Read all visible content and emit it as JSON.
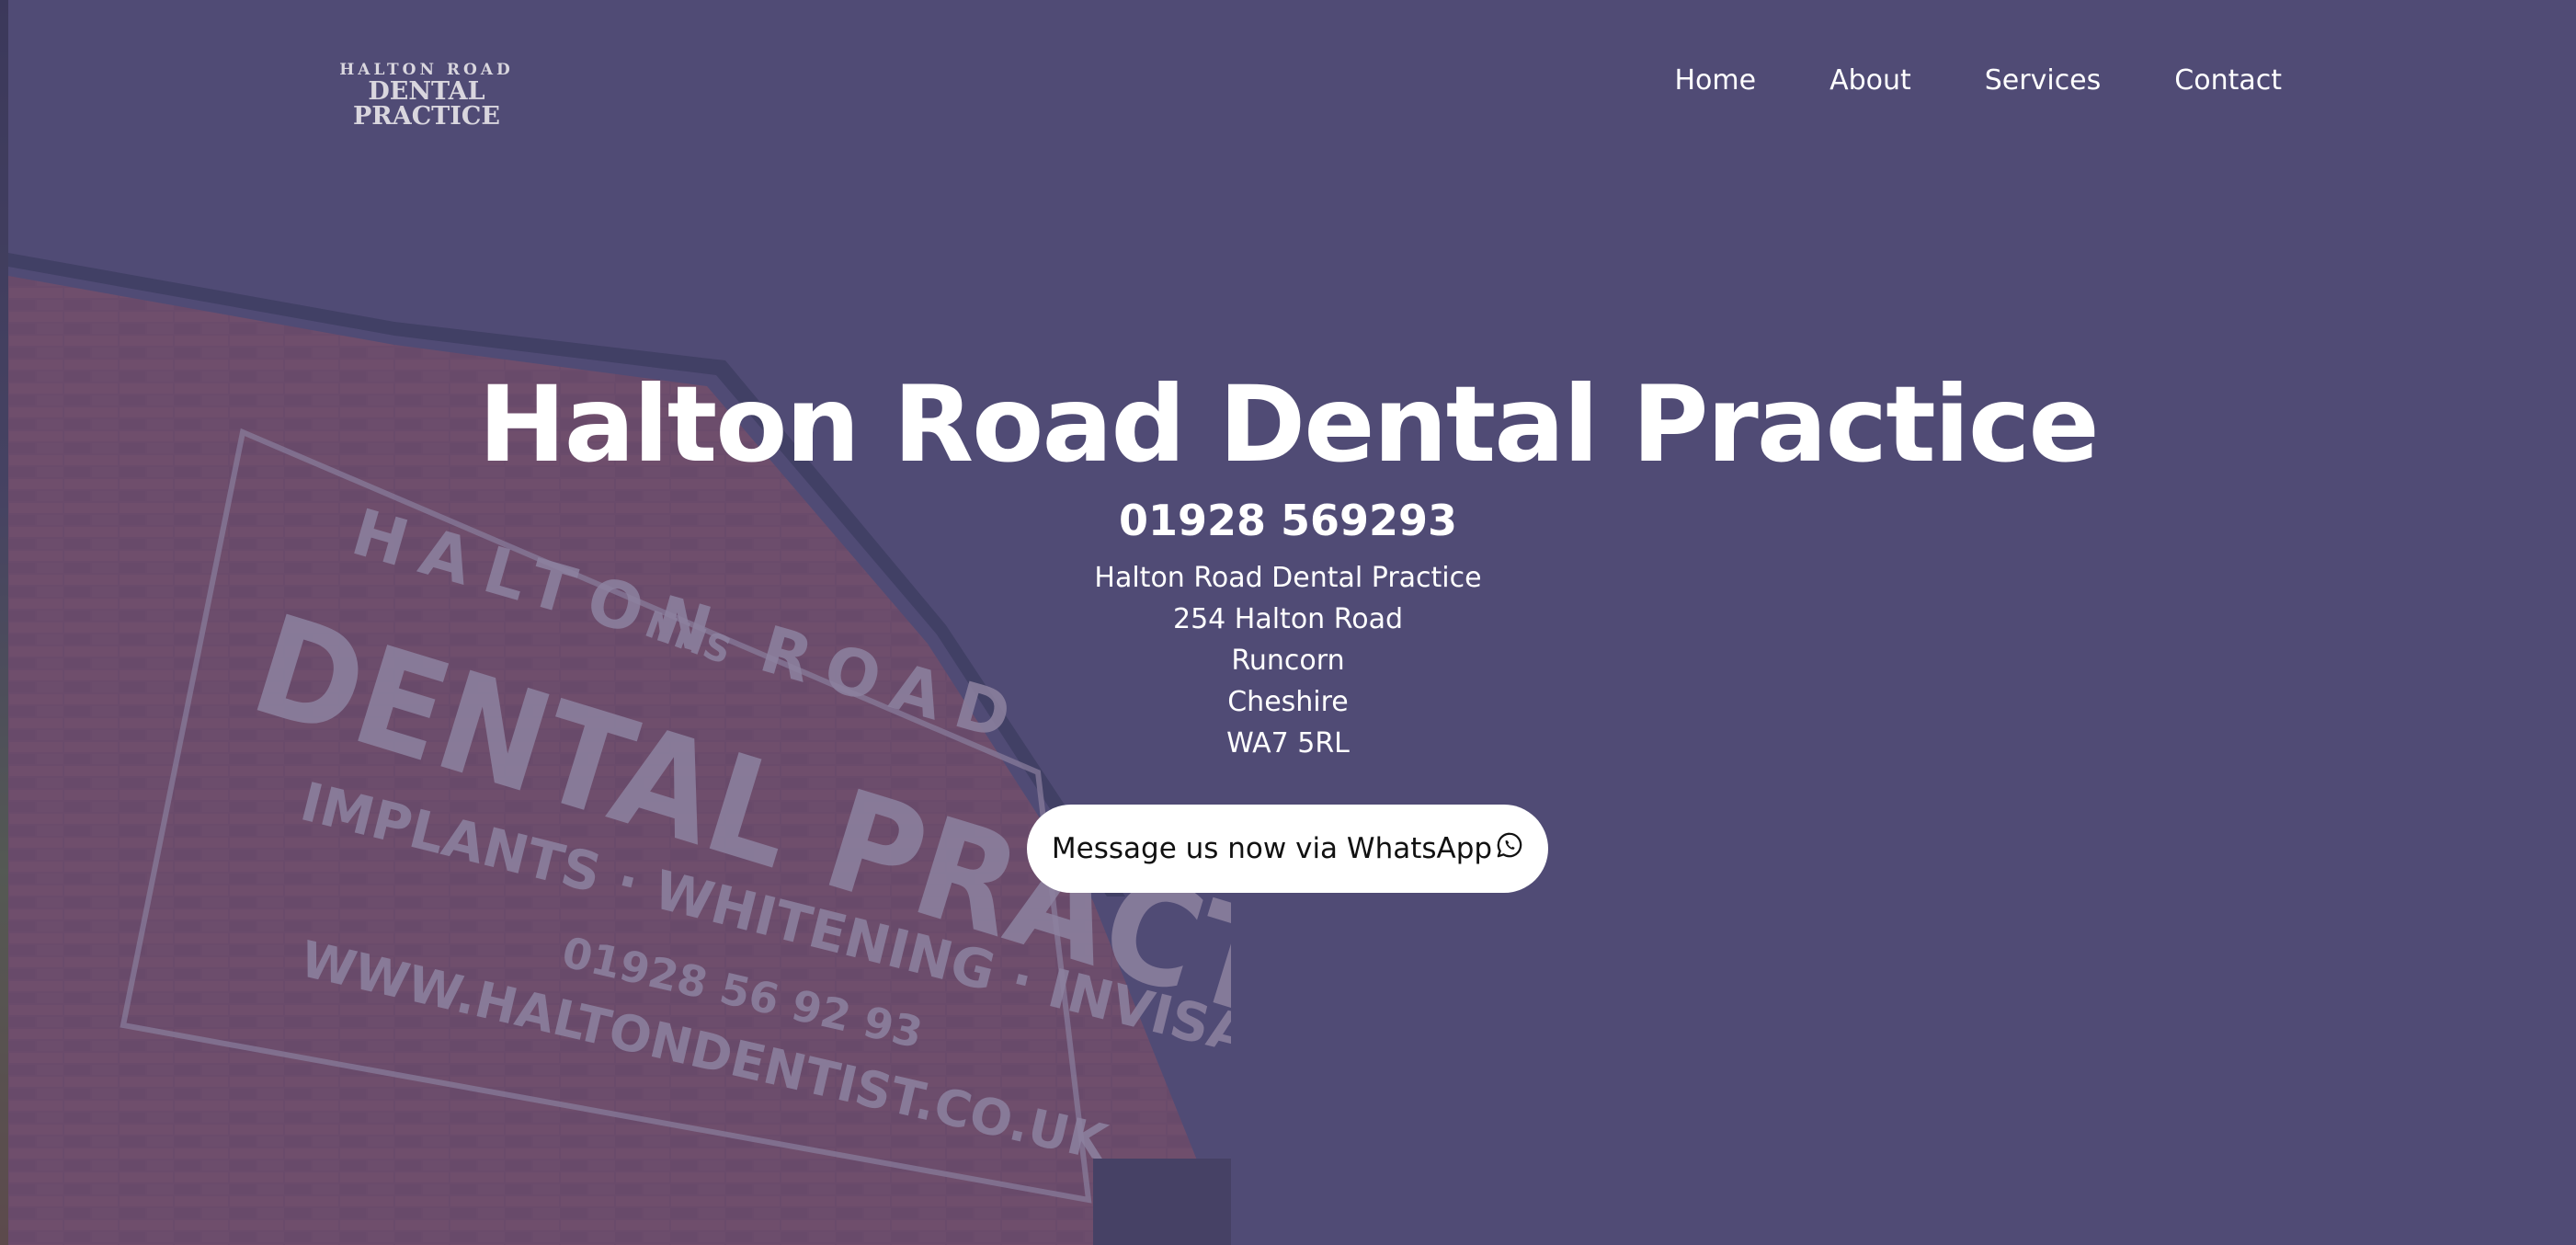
{
  "logo": {
    "line1": "HALTON ROAD",
    "line2": "DENTAL PRACTICE"
  },
  "nav": {
    "items": [
      {
        "label": "Home"
      },
      {
        "label": "About"
      },
      {
        "label": "Services"
      },
      {
        "label": "Contact"
      }
    ]
  },
  "hero": {
    "title": "Halton Road Dental Practice",
    "phone": "01928 569293",
    "address": [
      "Halton Road Dental Practice",
      "254 Halton Road",
      "Runcorn",
      "Cheshire",
      "WA7 5RL"
    ],
    "cta_label": "Message us now via WhatsApp",
    "cta_icon": "whatsapp-icon"
  },
  "wall_sign": {
    "line1": "HALTON ROAD",
    "badge": "NHS",
    "line2": "DENTAL PRACTICE",
    "services": "IMPLANTS · WHITENING · INVISALIGN",
    "phone": "01928 56 92 93",
    "web": "WWW.HALTONDENTIST.CO.UK"
  },
  "colors": {
    "overlay": "#514c74",
    "brick": "#8a4a5a",
    "text": "#ffffff",
    "button_bg": "#ffffff"
  }
}
